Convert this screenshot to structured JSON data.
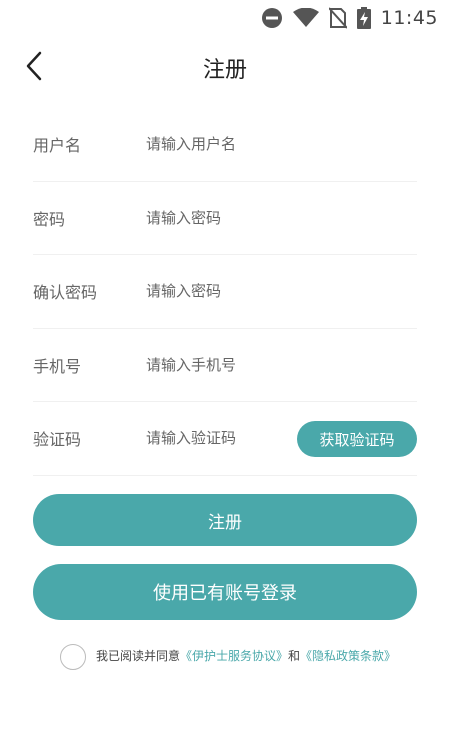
{
  "status_bar": {
    "time": "11:45",
    "icons": [
      "do-not-disturb-icon",
      "wifi-icon",
      "no-sim-icon",
      "battery-charging-icon"
    ]
  },
  "header": {
    "title": "注册",
    "back_icon": "chevron-left-icon"
  },
  "form": {
    "username": {
      "label": "用户名",
      "placeholder": "请输入用户名"
    },
    "password": {
      "label": "密码",
      "placeholder": "请输入密码"
    },
    "confirm_password": {
      "label": "确认密码",
      "placeholder": "请输入密码"
    },
    "phone": {
      "label": "手机号",
      "placeholder": "请输入手机号"
    },
    "verify_code": {
      "label": "验证码",
      "placeholder": "请输入验证码",
      "button_label": "获取验证码"
    }
  },
  "actions": {
    "register_label": "注册",
    "login_label": "使用已有账号登录"
  },
  "agreement": {
    "prefix": "我已阅读并同意",
    "service_link": "《伊护士服务协议》",
    "conjunction": "和",
    "privacy_link": "《隐私政策条款》"
  },
  "colors": {
    "accent": "#4aa8aa",
    "label": "#666666",
    "divider": "#f0f0f0"
  }
}
